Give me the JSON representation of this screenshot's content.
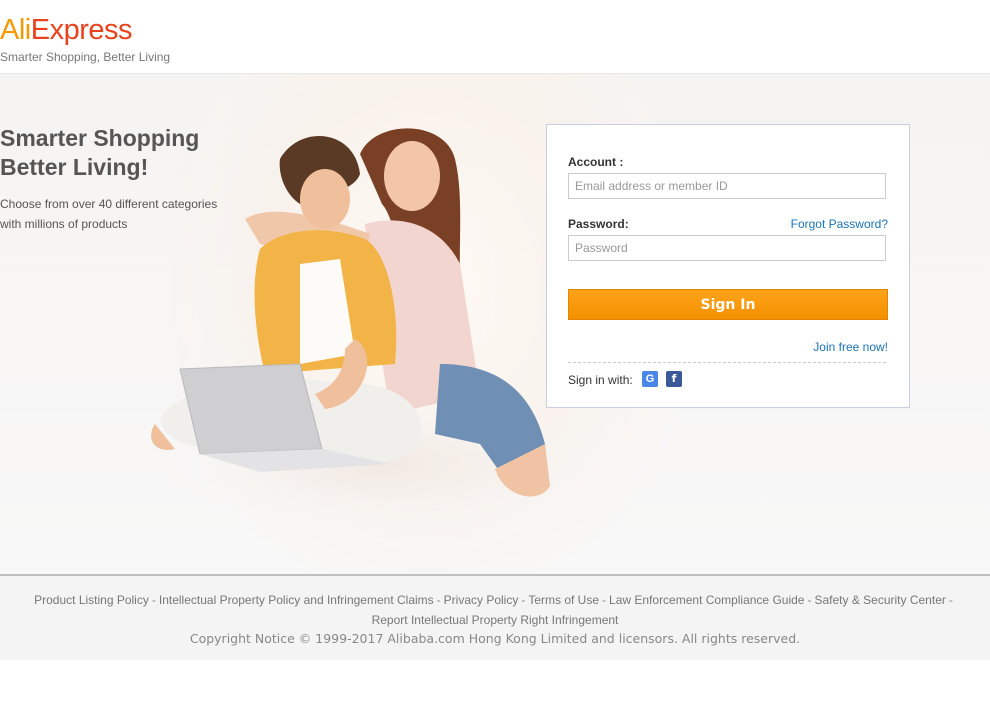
{
  "header": {
    "logo_part1": "Ali",
    "logo_part2": "Express",
    "tagline": "Smarter Shopping, Better Living"
  },
  "hero": {
    "title_line1": "Smarter Shopping",
    "title_line2": "Better Living!",
    "desc_line1": "Choose from over 40 different categories",
    "desc_line2": "with millions of products"
  },
  "login": {
    "account_label": "Account :",
    "account_placeholder": "Email address or member ID",
    "password_label": "Password:",
    "password_placeholder": "Password",
    "forgot_link": "Forgot Password?",
    "signin_button": "Sign In",
    "join_link": "Join free now!",
    "signin_with": "Sign in with:",
    "google_icon_char": "G",
    "facebook_icon_char": "f"
  },
  "footer": {
    "links": [
      "Product Listing Policy",
      "Intellectual Property Policy and Infringement Claims",
      "Privacy Policy",
      "Terms of Use",
      "Law Enforcement Compliance Guide",
      "Safety & Security Center",
      "Report Intellectual Property Right Infringement"
    ],
    "separator": "-",
    "copyright": "Copyright Notice © 1999-2017 Alibaba.com Hong Kong Limited and licensors. All rights reserved."
  },
  "colors": {
    "brand_orange": "#f59a00",
    "brand_red": "#e8431c",
    "button_orange": "#f39000",
    "link_blue": "#1a73b5"
  }
}
